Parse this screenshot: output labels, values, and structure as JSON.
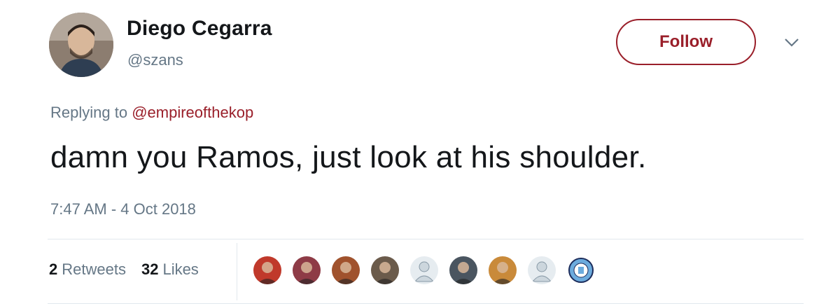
{
  "user": {
    "name": "Diego Cegarra",
    "handle": "@szans",
    "avatar_icon": "profile-photo-icon"
  },
  "header": {
    "follow_label": "Follow",
    "caret_icon": "chevron-down-icon"
  },
  "tweet": {
    "replying_prefix": "Replying to",
    "replying_to": "@empireofthekop",
    "text": "damn you Ramos, just look at his shoulder.",
    "timestamp": "7:47 AM - 4 Oct 2018"
  },
  "stats": {
    "retweets_count": "2",
    "retweets_label": "Retweets",
    "likes_count": "32",
    "likes_label": "Likes"
  },
  "likers": [
    {
      "icon": "liker-avatar-icon",
      "color": "#c0392b"
    },
    {
      "icon": "liker-avatar-icon",
      "color": "#8e3b46"
    },
    {
      "icon": "liker-avatar-icon",
      "color": "#a0522d"
    },
    {
      "icon": "liker-avatar-icon",
      "color": "#6b5b4b"
    },
    {
      "icon": "default-avatar-icon",
      "color": "#ccd6dd"
    },
    {
      "icon": "liker-avatar-icon",
      "color": "#4a5560"
    },
    {
      "icon": "liker-avatar-icon",
      "color": "#c98a3a"
    },
    {
      "icon": "default-avatar-icon",
      "color": "#ccd6dd"
    },
    {
      "icon": "club-crest-icon",
      "color": "#6cabdd"
    }
  ],
  "colors": {
    "accent": "#9a1f2a",
    "secondary_text": "#657786",
    "primary_text": "#14171a",
    "divider": "#e1e8ed"
  }
}
